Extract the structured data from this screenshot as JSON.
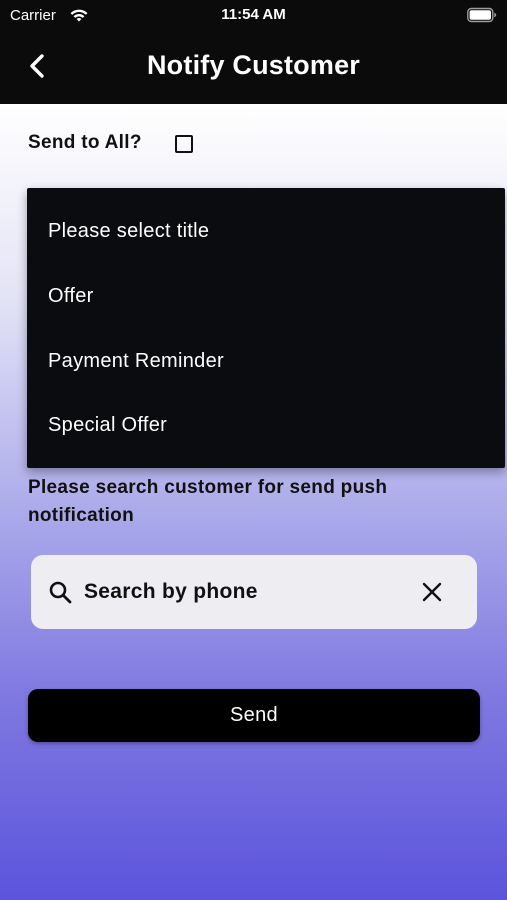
{
  "status_bar": {
    "carrier": "Carrier",
    "time": "11:54 AM",
    "wifi_icon": "wifi-icon",
    "battery_icon": "battery-icon"
  },
  "nav": {
    "back_icon": "chevron-left-icon",
    "title": "Notify Customer"
  },
  "send_to_all": {
    "label": "Send to All?",
    "checked": false
  },
  "title_dropdown": {
    "options": [
      "Please select title",
      "Offer",
      "Payment Reminder",
      "Special Offer"
    ]
  },
  "instruction": "Please search customer for send push notification",
  "search": {
    "placeholder": "Search by phone",
    "value": "",
    "search_icon": "search-icon",
    "clear_icon": "close-icon"
  },
  "send_button": {
    "label": "Send"
  },
  "colors": {
    "header_bg": "#0b0b0b",
    "gradient_top": "#ffffff",
    "gradient_bottom": "#5c54dc",
    "search_bg": "#eeedf2",
    "button_bg": "#000000"
  }
}
